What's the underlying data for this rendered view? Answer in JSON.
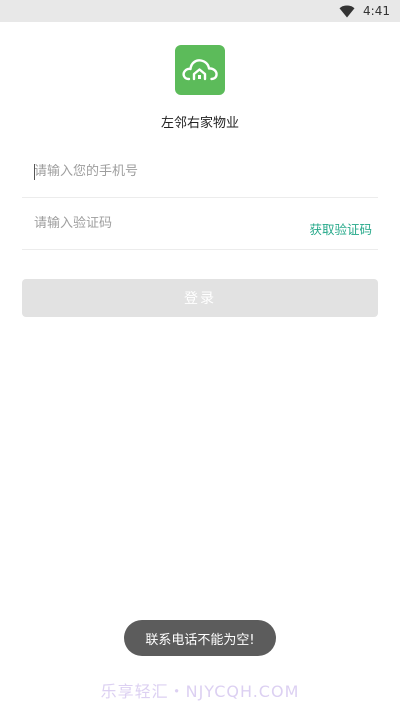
{
  "status_bar": {
    "time": "4:41",
    "wifi_icon": "wifi-icon"
  },
  "app": {
    "logo_icon": "cloud-home-icon",
    "name": "左邻右家物业",
    "brand_color": "#5cbb5a"
  },
  "form": {
    "phone_placeholder": "请输入您的手机号",
    "phone_value": "",
    "code_placeholder": "请输入验证码",
    "code_value": "",
    "get_code_label": "获取验证码",
    "link_color": "#26a98a"
  },
  "login_button": {
    "label": "登录",
    "enabled": false
  },
  "toast": {
    "message": "联系电话不能为空!"
  },
  "watermark": {
    "text": "乐享轻汇・NJYCQH.COM"
  }
}
